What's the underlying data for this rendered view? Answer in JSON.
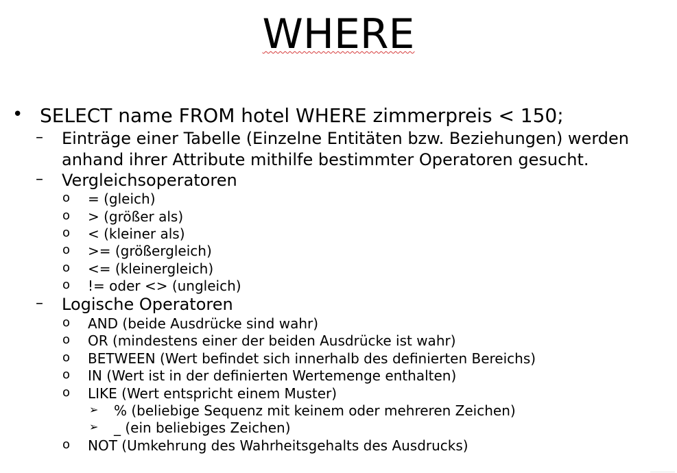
{
  "slide": {
    "title": "WHERE",
    "bullet_glyph": "•",
    "dash_glyph": "–",
    "circle_glyph": "o",
    "arrow_glyph": "➢",
    "main_statement": "SELECT name FROM hotel WHERE zimmerpreis < 150;",
    "description_line1": "Einträge einer Tabelle (Einzelne Entitäten bzw. Beziehungen) werden",
    "description_line2": "anhand ihrer Attribute mithilfe bestimmter Operatoren gesucht.",
    "comparison_heading": "Vergleichsoperatoren",
    "comparison_items": [
      "= (gleich)",
      "> (größer als)",
      "< (kleiner als)",
      ">= (größergleich)",
      "<= (kleinergleich)",
      "!= oder <> (ungleich)"
    ],
    "logical_heading": "Logische Operatoren",
    "logical_items": [
      "AND (beide Ausdrücke sind wahr)",
      "OR (mindestens einer der beiden Ausdrücke ist wahr)",
      "BETWEEN (Wert befindet sich innerhalb des definierten Bereichs)",
      "IN (Wert ist in der definierten Wertemenge enthalten)",
      "LIKE (Wert entspricht einem Muster)"
    ],
    "like_subitems": [
      "% (beliebige Sequenz mit keinem oder mehreren Zeichen)",
      "_ (ein beliebiges Zeichen)"
    ],
    "not_item": "NOT (Umkehrung des Wahrheitsgehalts des Ausdrucks)"
  }
}
